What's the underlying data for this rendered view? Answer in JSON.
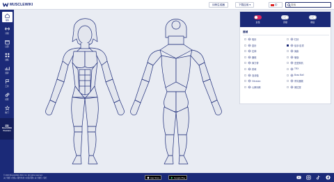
{
  "header": {
    "logo_text": "MUSCLEWIKI",
    "btn_workout": "训练生成器",
    "btn_plan": "下载应用 ▾",
    "lang": "中",
    "search_placeholder": "搜索"
  },
  "sidebar": {
    "items": [
      {
        "label": "锻炼",
        "icon": "home-icon"
      },
      {
        "label": "计划",
        "icon": "dumbbell-icon"
      },
      {
        "label": "日历",
        "icon": "calendar-icon"
      },
      {
        "label": "训练",
        "icon": "grid-icon"
      },
      {
        "label": "营养",
        "icon": "chart-icon"
      },
      {
        "label": "工具",
        "icon": "flag-icon"
      },
      {
        "label": "社区",
        "icon": "link-icon"
      },
      {
        "label": "热门",
        "icon": "star-icon"
      },
      {
        "label": "记录",
        "icon": "trophy-icon"
      },
      {
        "label": "更多",
        "icon": "menu-icon"
      }
    ],
    "promo_line1": "获取",
    "promo_line2": "MuscleWiki",
    "promo_line3": "Premium"
  },
  "panel": {
    "toggles": [
      {
        "label": "女性",
        "on": true
      },
      {
        "label": "高级",
        "on": false
      },
      {
        "label": "前后",
        "on": false
      }
    ],
    "section_label": "器械",
    "equipment": [
      {
        "label": "哑铃",
        "checked": false
      },
      {
        "label": "杠铃",
        "checked": false
      },
      {
        "label": "壶铃",
        "checked": false
      },
      {
        "label": "徒手/自重",
        "checked": true
      },
      {
        "label": "拉伸",
        "checked": false
      },
      {
        "label": "绳索",
        "checked": false
      },
      {
        "label": "器械",
        "checked": false
      },
      {
        "label": "瑜伽",
        "checked": false
      },
      {
        "label": "弹力带",
        "checked": false
      },
      {
        "label": "史密斯机",
        "checked": false
      },
      {
        "label": "药球",
        "checked": false
      },
      {
        "label": "TRX",
        "checked": false
      },
      {
        "label": "泡沫轴",
        "checked": false
      },
      {
        "label": "Bosu Ball",
        "checked": false
      },
      {
        "label": "Vitruvian",
        "checked": false
      },
      {
        "label": "有氧器械",
        "checked": false
      },
      {
        "label": "心肺训练",
        "checked": false
      },
      {
        "label": "普拉提",
        "checked": false
      }
    ]
  },
  "footer": {
    "copyright": "© 2024 MuscleWiki 2024. Inc. All rights reserved.",
    "links": "关于我们 | 隐私 | 服务条款 | 常见问题 | 关于我们 | 专栏",
    "app_store": "App Store",
    "google_play": "Google Play",
    "social": [
      "youtube-icon",
      "instagram-icon",
      "tiktok-icon",
      "facebook-icon"
    ]
  },
  "colors": {
    "brand": "#1b2a78",
    "accent": "#e3245c",
    "background": "#e9ecf3"
  }
}
